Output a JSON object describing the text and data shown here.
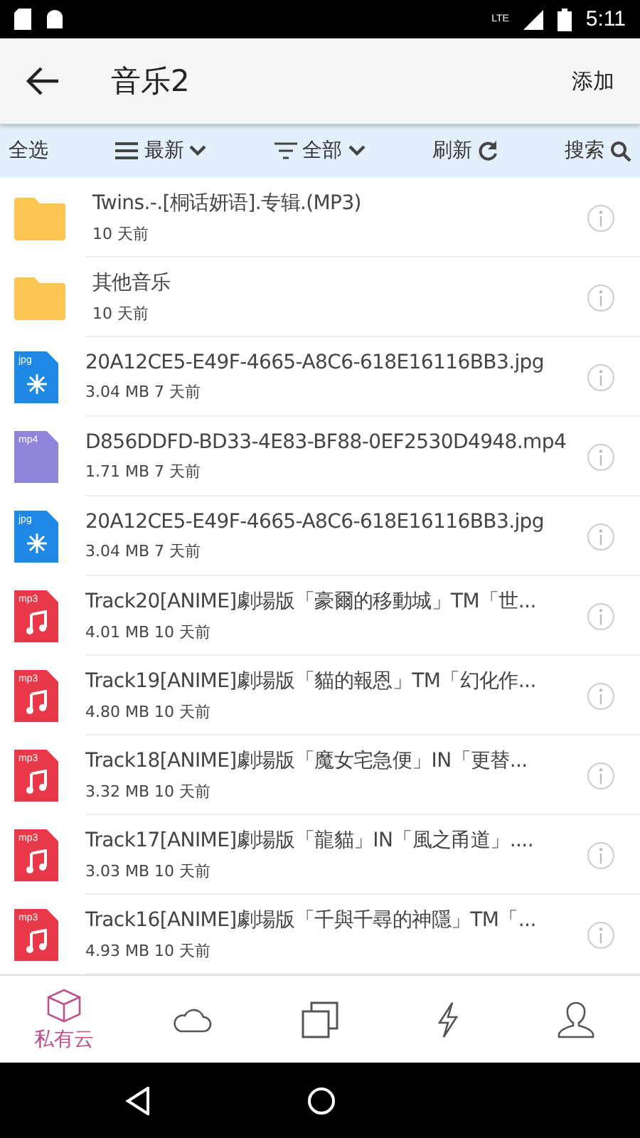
{
  "status_bar": {
    "network": "LTE",
    "time": "5:11"
  },
  "app_bar": {
    "title": "音乐2",
    "action": "添加"
  },
  "toolbar": {
    "select_all": "全选",
    "sort": "最新",
    "filter": "全部",
    "refresh": "刷新",
    "search": "搜索"
  },
  "files": [
    {
      "kind": "folder",
      "name": "Twins.-.[桐话妍语].专辑.(MP3)",
      "meta": "10 天前"
    },
    {
      "kind": "folder",
      "name": "其他音乐",
      "meta": "10 天前"
    },
    {
      "kind": "jpg",
      "icon_label": "jpg",
      "name": "20A12CE5-E49F-4665-A8C6-618E16116BB3.jpg",
      "meta": "3.04 MB 7 天前"
    },
    {
      "kind": "mp4",
      "icon_label": "mp4",
      "name": "D856DDFD-BD33-4E83-BF88-0EF2530D4948.mp4",
      "meta": "1.71 MB 7 天前"
    },
    {
      "kind": "jpg",
      "icon_label": "jpg",
      "name": "20A12CE5-E49F-4665-A8C6-618E16116BB3.jpg",
      "meta": "3.04 MB 7 天前"
    },
    {
      "kind": "mp3",
      "icon_label": "mp3",
      "name": "Track20[ANIME]劇場版「豪爾的移動城」TM「世...",
      "meta": "4.01 MB 10 天前"
    },
    {
      "kind": "mp3",
      "icon_label": "mp3",
      "name": "Track19[ANIME]劇場版「貓的報恩」TM「幻化作...",
      "meta": "4.80 MB 10 天前"
    },
    {
      "kind": "mp3",
      "icon_label": "mp3",
      "name": "Track18[ANIME]劇場版「魔女宅急便」IN「更替...",
      "meta": "3.32 MB 10 天前"
    },
    {
      "kind": "mp3",
      "icon_label": "mp3",
      "name": "Track17[ANIME]劇場版「龍貓」IN「風之甬道」....",
      "meta": "3.03 MB 10 天前"
    },
    {
      "kind": "mp3",
      "icon_label": "mp3",
      "name": "Track16[ANIME]劇場版「千與千尋的神隱」TM「...",
      "meta": "4.93 MB 10 天前"
    }
  ],
  "tabs": [
    {
      "kind": "cube",
      "label": "私有云",
      "selected": true
    },
    {
      "kind": "cloud",
      "selected": false
    },
    {
      "kind": "copy",
      "selected": false
    },
    {
      "kind": "bolt",
      "selected": false
    },
    {
      "kind": "person",
      "selected": false
    }
  ]
}
